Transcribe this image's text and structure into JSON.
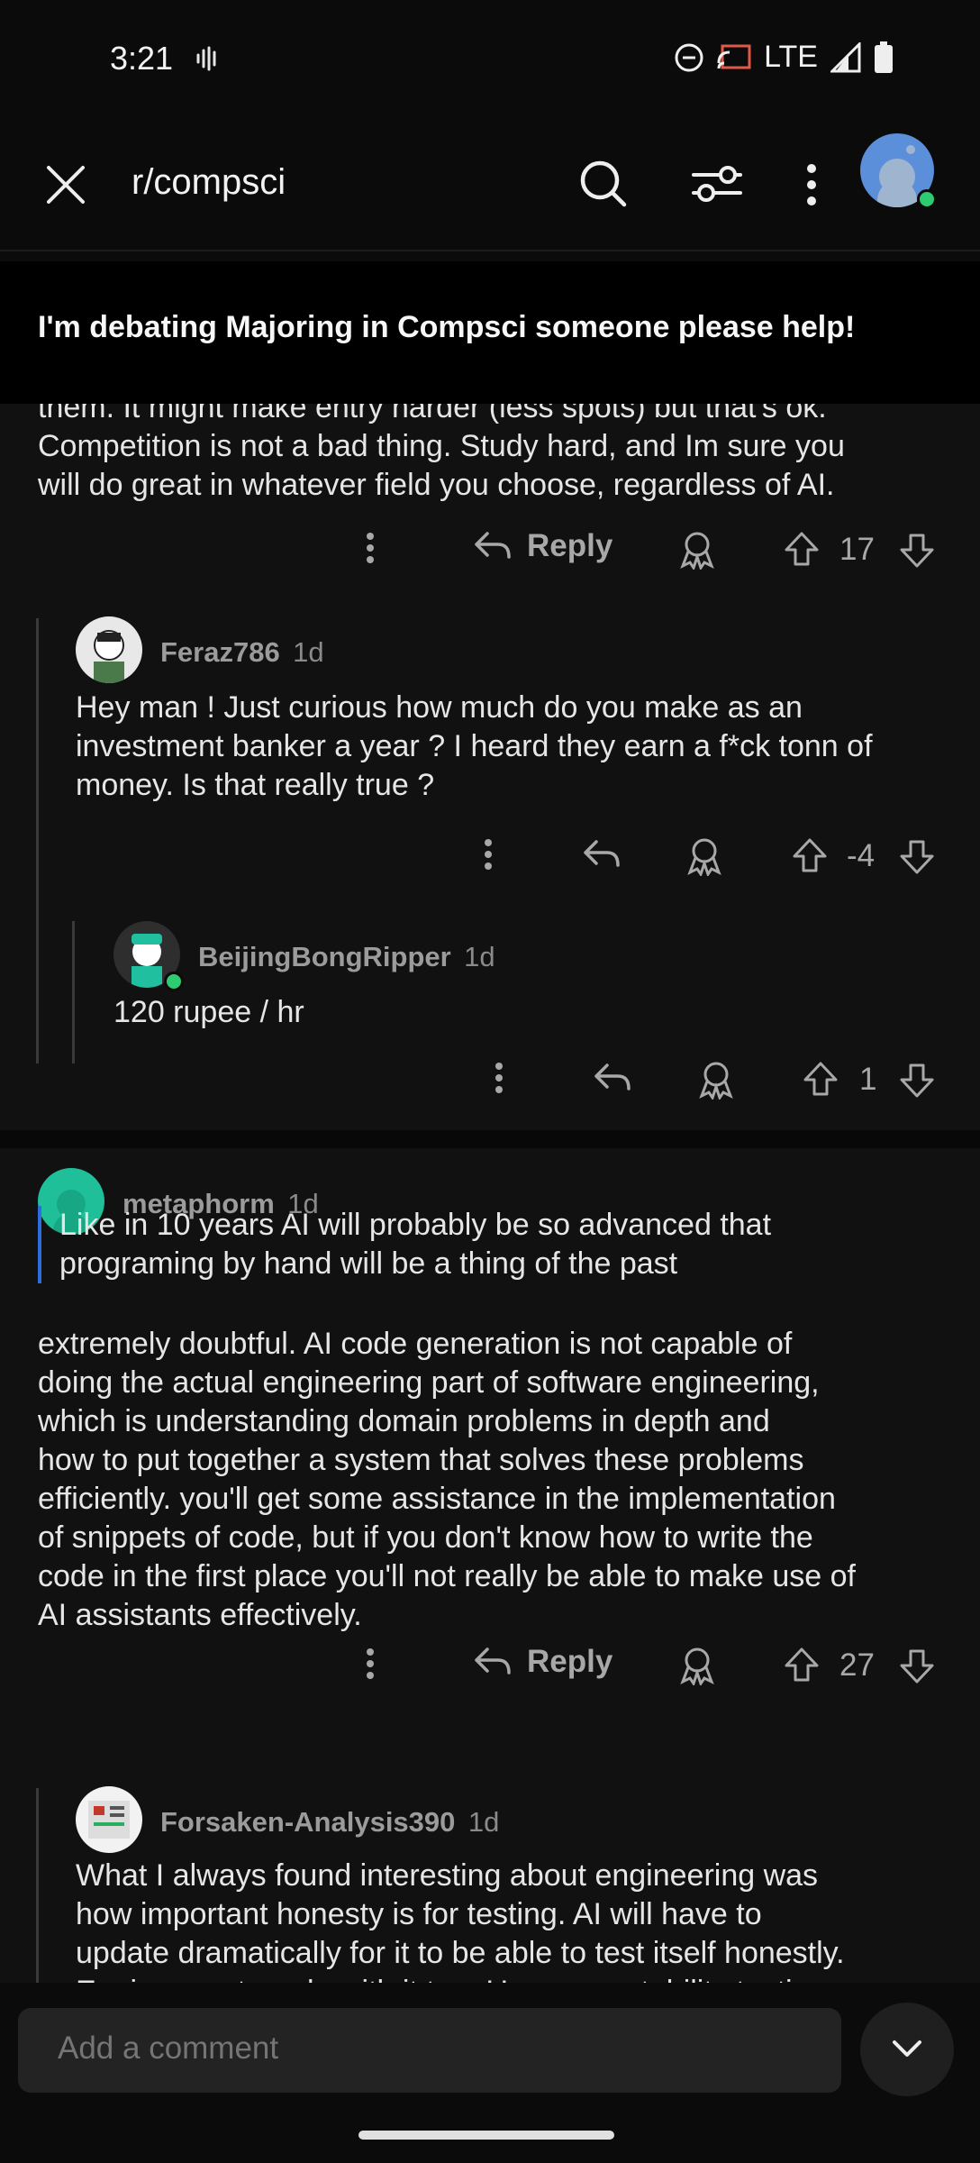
{
  "status": {
    "time": "3:21",
    "network": "LTE"
  },
  "header": {
    "subreddit": "r/compsci"
  },
  "post": {
    "title": "I'm debating Majoring in Compsci someone please help!"
  },
  "comment_top": {
    "lines": [
      "them. It might make entry harder (less spots) but that's ok.",
      "Competition is not a bad thing. Study hard, and Im sure you",
      "will do great in whatever field you choose, regardless of AI."
    ],
    "reply_label": "Reply",
    "score": "17"
  },
  "reply1": {
    "user": "Feraz786",
    "age": "1d",
    "lines": [
      "Hey man ! Just curious how much do you make as an",
      "investment banker a year ? I heard they earn a f*ck tonn of",
      "money. Is that really true ?"
    ],
    "score": "-4"
  },
  "reply2": {
    "user": "BeijingBongRipper",
    "age": "1d",
    "text": "120 rupee / hr",
    "score": "1"
  },
  "comment2": {
    "user": "metaphorm",
    "age": "1d",
    "quote_lines": [
      "Like in 10 years AI will probably be so advanced that",
      "programing by hand will be a thing of the past"
    ],
    "lines": [
      "extremely doubtful. AI code generation is not capable of",
      "doing the actual engineering part of software engineering,",
      "which is understanding domain problems in depth and",
      "how to put together a system that solves these problems",
      "efficiently. you'll get some assistance in the implementation",
      "of snippets of code, but if you don't know how to write the",
      "code in the first place you'll not really be able to make use of",
      "AI assistants effectively."
    ],
    "reply_label": "Reply",
    "score": "27"
  },
  "reply3": {
    "user": "Forsaken-Analysis390",
    "age": "1d",
    "lines": [
      "What I always found interesting about engineering was",
      "how important honesty is for testing. AI will have to",
      "update dramatically for it to be able to test itself honestly.",
      "Engineers struggle with it too. User acceptability testing"
    ]
  },
  "composer": {
    "placeholder": "Add a comment"
  },
  "icons": {
    "close": "close-icon",
    "search": "search-icon",
    "filter": "filter-icon",
    "more": "more-vertical-icon",
    "reply": "reply-icon",
    "award": "award-icon",
    "upvote": "upvote-icon",
    "downvote": "downvote-icon",
    "chevron": "chevron-down-icon"
  },
  "colors": {
    "background": "#0b0b0b",
    "quote_bar": "#2d6de0",
    "online": "#2ecc71"
  }
}
